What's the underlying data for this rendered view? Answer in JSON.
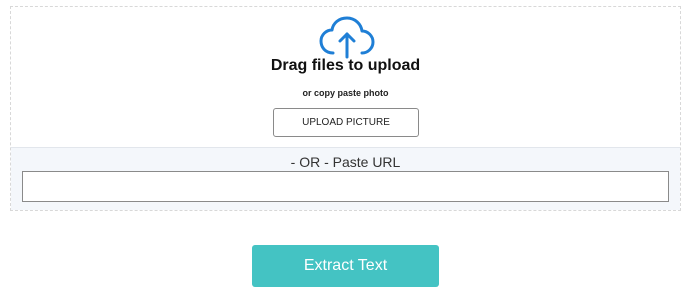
{
  "upload": {
    "icon": "cloud-upload-icon",
    "title": "Drag files to upload",
    "subtitle": "or copy paste photo",
    "button_label": "UPLOAD PICTURE"
  },
  "url": {
    "label": "- OR - Paste URL",
    "value": ""
  },
  "actions": {
    "extract_label": "Extract Text"
  },
  "colors": {
    "icon_blue": "#1f7fd6",
    "extract_button": "#44c3c3",
    "url_panel_bg": "#f4f7fb"
  }
}
